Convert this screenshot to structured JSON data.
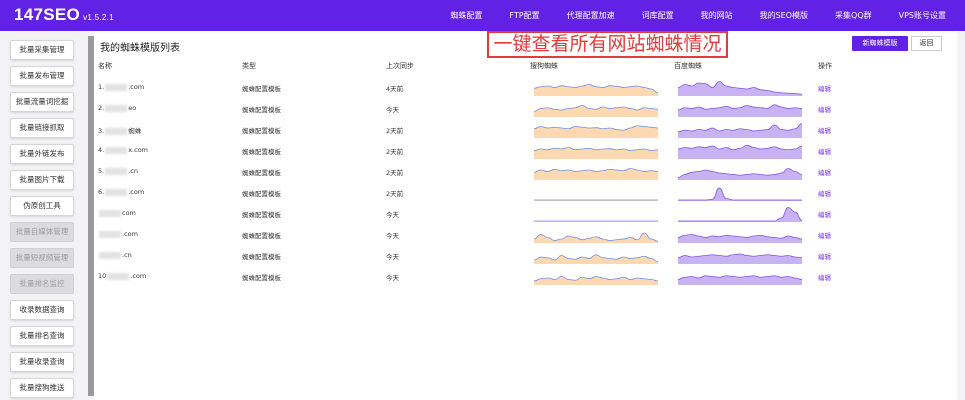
{
  "topbar": {
    "brand": "147SEO",
    "version": "v1.5.2.1",
    "nav": [
      "蜘蛛配置",
      "FTP配置",
      "代理配置加速",
      "词库配置",
      "我的网站",
      "我的SEO模版",
      "采集QQ群",
      "VPS账号设置"
    ]
  },
  "sidebar": {
    "items": [
      {
        "label": "批量采集管理",
        "disabled": false
      },
      {
        "label": "批量发布管理",
        "disabled": false
      },
      {
        "label": "批量流量词挖掘",
        "disabled": false
      },
      {
        "label": "批量链接抓取",
        "disabled": false
      },
      {
        "label": "批量外链发布",
        "disabled": false
      },
      {
        "label": "批量图片下载",
        "disabled": false
      },
      {
        "label": "伪原创工具",
        "disabled": false
      },
      {
        "label": "批量自媒体管理",
        "disabled": true
      },
      {
        "label": "批量短视频管理",
        "disabled": true
      },
      {
        "label": "批量排名监控",
        "disabled": true
      },
      {
        "label": "收录数据查询",
        "disabled": false
      },
      {
        "label": "批量排名查询",
        "disabled": false
      },
      {
        "label": "批量收录查询",
        "disabled": false
      },
      {
        "label": "批量搜狗推送",
        "disabled": false
      }
    ]
  },
  "main": {
    "title": "我的蜘蛛模版列表",
    "callout": "一键查看所有网站蜘蛛情况",
    "new_button": "新蜘蛛模版",
    "back_button": "返回",
    "columns": [
      "名称",
      "类型",
      "上次同步",
      "搜狗蜘蛛",
      "百度蜘蛛",
      "操作"
    ],
    "rows": [
      {
        "name_prefix": "1.",
        "name_suffix": ".com",
        "type": "蜘蛛配置模板",
        "sync": "4天前",
        "action": "编辑",
        "sogou": [
          0.45,
          0.55,
          0.6,
          0.5,
          0.62,
          0.55,
          0.5,
          0.6,
          0.7,
          0.55,
          0.5,
          0.62,
          0.58,
          0.5,
          0.55,
          0.6,
          0.5,
          0.4,
          0.15
        ],
        "baidu": [
          0.5,
          0.7,
          0.6,
          0.8,
          0.75,
          0.5,
          0.9,
          0.6,
          0.5,
          0.45,
          0.4,
          0.5,
          0.35,
          0.3,
          0.2,
          0.15,
          0.12,
          0.1,
          0.05
        ]
      },
      {
        "name_prefix": "2.",
        "name_suffix": "eo",
        "type": "蜘蛛配置模板",
        "sync": "今天",
        "action": "编辑",
        "sogou": [
          0.3,
          0.5,
          0.55,
          0.45,
          0.4,
          0.5,
          0.55,
          0.7,
          0.5,
          0.45,
          0.6,
          0.5,
          0.55,
          0.6,
          0.5,
          0.4,
          0.55,
          0.5,
          0.45
        ],
        "baidu": [
          0.4,
          0.55,
          0.5,
          0.6,
          0.45,
          0.5,
          0.55,
          0.65,
          0.5,
          0.55,
          0.7,
          0.6,
          0.55,
          0.5,
          0.75,
          0.6,
          0.5,
          0.55,
          0.5
        ]
      },
      {
        "name_prefix": "3.",
        "name_suffix": "蜘蛛",
        "type": "蜘蛛配置模板",
        "sync": "2天前",
        "action": "编辑",
        "sogou": [
          0.55,
          0.7,
          0.6,
          0.65,
          0.6,
          0.55,
          0.7,
          0.65,
          0.6,
          0.62,
          0.55,
          0.6,
          0.5,
          0.45,
          0.6,
          0.75,
          0.7,
          0.65,
          0.6
        ],
        "baidu": [
          0.35,
          0.45,
          0.4,
          0.5,
          0.45,
          0.6,
          0.4,
          0.5,
          0.45,
          0.55,
          0.5,
          0.4,
          0.45,
          0.5,
          0.8,
          0.5,
          0.45,
          0.55,
          0.9
        ]
      },
      {
        "name_prefix": "4.",
        "name_suffix": "x.com",
        "type": "蜘蛛配置模板",
        "sync": "2天前",
        "action": "编辑",
        "sogou": [
          0.5,
          0.6,
          0.55,
          0.65,
          0.6,
          0.7,
          0.55,
          0.6,
          0.65,
          0.55,
          0.6,
          0.62,
          0.55,
          0.6,
          0.5,
          0.55,
          0.6,
          0.5,
          0.55
        ],
        "baidu": [
          0.6,
          0.7,
          0.65,
          0.75,
          0.7,
          0.8,
          0.6,
          0.7,
          0.55,
          0.65,
          0.85,
          0.7,
          0.6,
          0.65,
          0.75,
          0.6,
          0.55,
          0.6,
          0.8
        ]
      },
      {
        "name_prefix": "5.",
        "name_suffix": ".cn",
        "type": "蜘蛛配置模板",
        "sync": "2天前",
        "action": "编辑",
        "sogou": [
          0.45,
          0.6,
          0.5,
          0.65,
          0.55,
          0.6,
          0.5,
          0.55,
          0.6,
          0.5,
          0.55,
          0.65,
          0.6,
          0.55,
          0.7,
          0.6,
          0.5,
          0.55,
          0.5
        ],
        "baidu": [
          0.1,
          0.3,
          0.45,
          0.5,
          0.6,
          0.5,
          0.4,
          0.35,
          0.3,
          0.25,
          0.3,
          0.35,
          0.3,
          0.25,
          0.3,
          0.4,
          0.7,
          0.5,
          0.3
        ]
      },
      {
        "name_prefix": "6.",
        "name_suffix": ".com",
        "type": "蜘蛛配置模板",
        "sync": "2天前",
        "action": "编辑",
        "sogou": [
          0,
          0,
          0,
          0,
          0,
          0,
          0,
          0,
          0,
          0,
          0,
          0,
          0,
          0,
          0,
          0,
          0,
          0,
          0
        ],
        "baidu": [
          0,
          0,
          0,
          0,
          0,
          0.05,
          0.8,
          0.1,
          0,
          0,
          0,
          0,
          0,
          0,
          0,
          0,
          0,
          0,
          0
        ]
      },
      {
        "name_prefix": "",
        "name_suffix": "com",
        "type": "蜘蛛配置模板",
        "sync": "今天",
        "action": "编辑",
        "sogou": [
          0,
          0,
          0,
          0,
          0,
          0,
          0,
          0,
          0,
          0,
          0,
          0,
          0,
          0,
          0,
          0,
          0,
          0,
          0
        ],
        "baidu": [
          0,
          0,
          0,
          0,
          0,
          0,
          0,
          0,
          0,
          0,
          0,
          0,
          0,
          0,
          0,
          0.2,
          0.9,
          0.6,
          0.05
        ]
      },
      {
        "name_prefix": "",
        "name_suffix": ".com",
        "type": "蜘蛛配置模板",
        "sync": "今天",
        "action": "编辑",
        "sogou": [
          0.2,
          0.5,
          0.3,
          0.1,
          0.2,
          0.4,
          0.3,
          0.15,
          0.25,
          0.35,
          0.2,
          0.1,
          0.15,
          0.2,
          0.3,
          0.15,
          0.6,
          0.2,
          0.05
        ],
        "baidu": [
          0.3,
          0.45,
          0.5,
          0.4,
          0.3,
          0.4,
          0.35,
          0.45,
          0.4,
          0.35,
          0.3,
          0.4,
          0.45,
          0.35,
          0.3,
          0.25,
          0.4,
          0.3,
          0.2
        ]
      },
      {
        "name_prefix": "",
        "name_suffix": ".cn",
        "type": "蜘蛛配置模板",
        "sync": "今天",
        "action": "编辑",
        "sogou": [
          0.2,
          0.4,
          0.35,
          0.2,
          0.5,
          0.3,
          0.25,
          0.4,
          0.3,
          0.55,
          0.35,
          0.3,
          0.25,
          0.4,
          0.3,
          0.35,
          0.45,
          0.3,
          0.1
        ],
        "baidu": [
          0.35,
          0.5,
          0.4,
          0.45,
          0.5,
          0.55,
          0.5,
          0.45,
          0.55,
          0.6,
          0.5,
          0.45,
          0.5,
          0.55,
          0.5,
          0.45,
          0.5,
          0.4,
          0.35
        ]
      },
      {
        "name_prefix": "10",
        "name_suffix": ".com",
        "type": "蜘蛛配置模板",
        "sync": "今天",
        "action": "编辑",
        "sogou": [
          0.2,
          0.35,
          0.4,
          0.3,
          0.5,
          0.3,
          0.25,
          0.45,
          0.35,
          0.5,
          0.4,
          0.3,
          0.35,
          0.45,
          0.3,
          0.4,
          0.35,
          0.3,
          0.2
        ],
        "baidu": [
          0.3,
          0.45,
          0.5,
          0.4,
          0.55,
          0.5,
          0.45,
          0.55,
          0.5,
          0.45,
          0.5,
          0.55,
          0.45,
          0.5,
          0.55,
          0.45,
          0.5,
          0.4,
          0.3
        ]
      }
    ]
  },
  "colors": {
    "brand": "#6222e6",
    "sogou_fill": "#fdd8b0",
    "sogou_line": "#6c8fe0",
    "baidu_fill": "#c9b2f2",
    "baidu_line": "#7d55e0",
    "callout": "#e23b3b",
    "edit": "#7b2ff0"
  }
}
